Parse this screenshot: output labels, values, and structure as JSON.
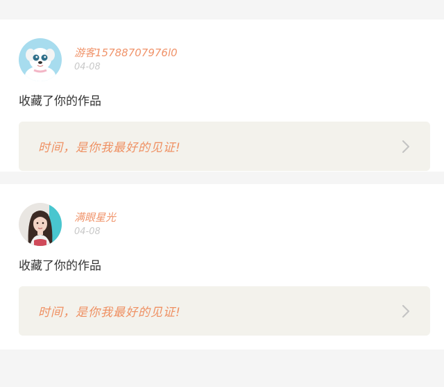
{
  "feed": [
    {
      "username": "游客15788707976l0",
      "date": "04-08",
      "action": "收藏了你的作品",
      "link_text": "时间，是你我最好的见证!",
      "avatar_icon": "puppy-avatar"
    },
    {
      "username": "满眼星光",
      "date": "04-08",
      "action": "收藏了你的作品",
      "link_text": "时间，是你我最好的见证!",
      "avatar_icon": "girl-avatar"
    }
  ],
  "colors": {
    "accent": "#f0936a",
    "date": "#c8c8c8",
    "link_bg": "#f3f2ec",
    "page_bg": "#f5f5f5"
  }
}
